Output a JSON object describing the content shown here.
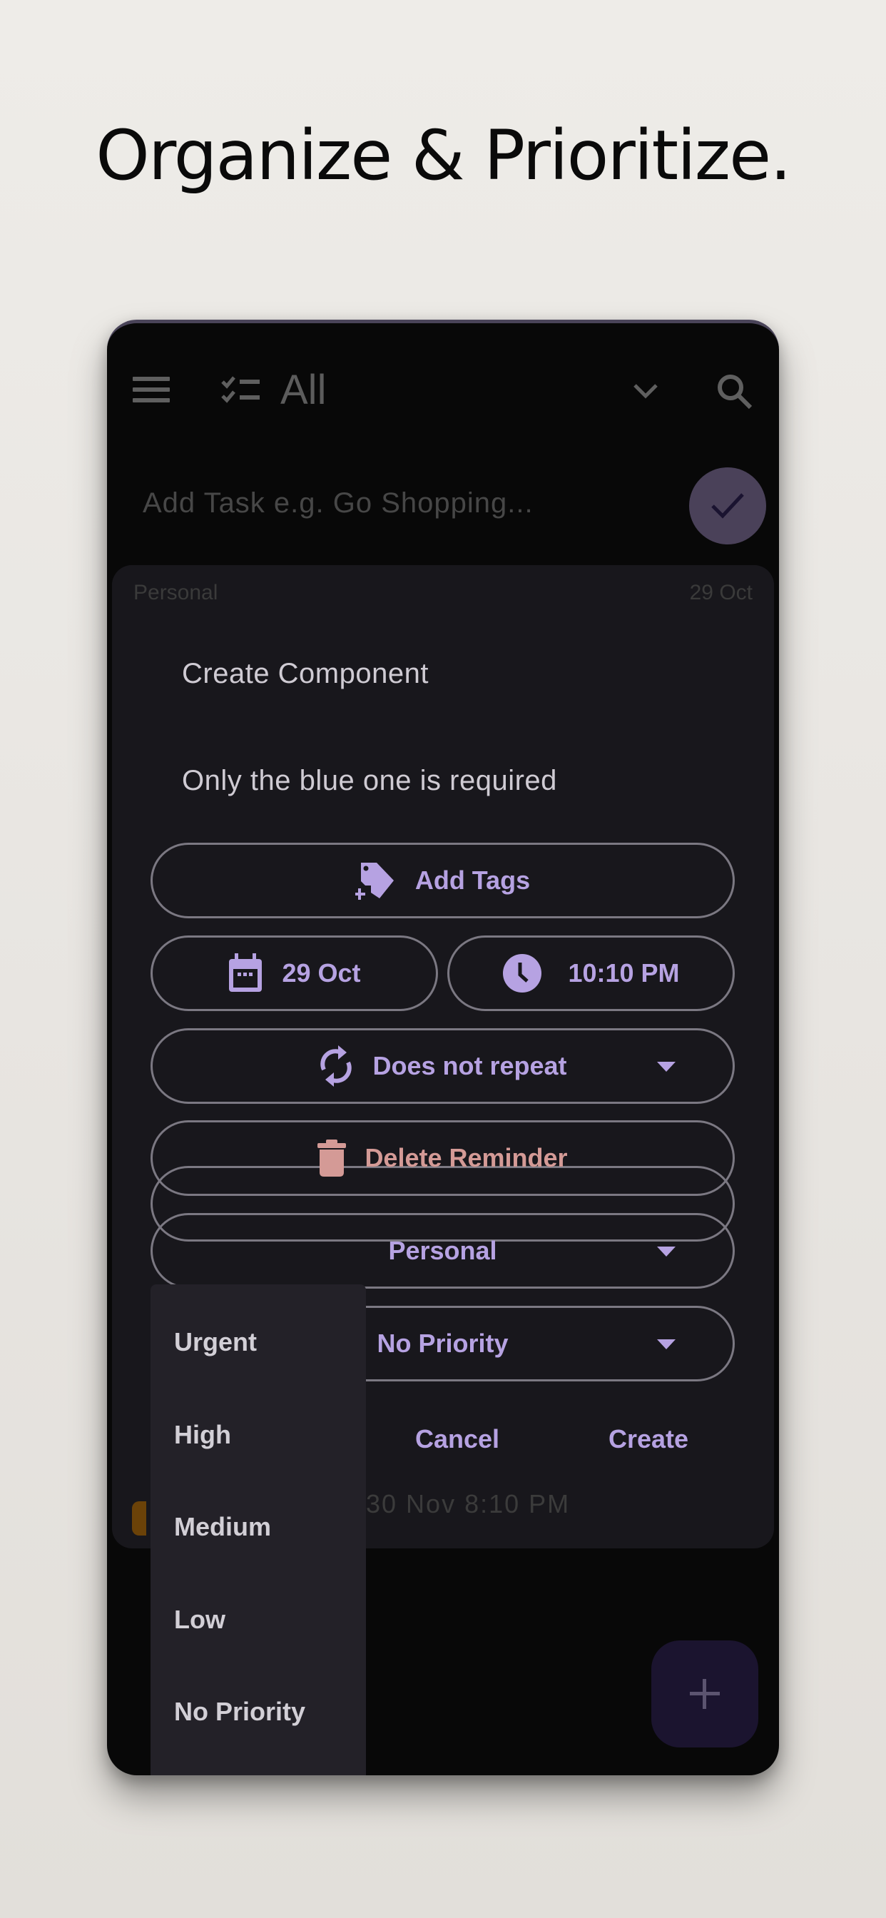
{
  "headline": "Organize & Prioritize.",
  "app_header": {
    "title": "All",
    "icons": [
      "menu-icon",
      "checklist-icon",
      "chevron-down-icon",
      "search-icon"
    ]
  },
  "add_task": {
    "placeholder": "Add Task e.g. Go Shopping...",
    "submit_icon": "check-icon"
  },
  "background_tasks": [
    {
      "category": "Personal",
      "date": "29 Oct"
    },
    {
      "date": "30 Nov 8:10 PM"
    }
  ],
  "dialog": {
    "title": "Create Component",
    "subtitle": "Only the blue one is required",
    "add_tags": {
      "label": "Add Tags",
      "icon": "tag-plus-icon"
    },
    "date": {
      "label": "29 Oct",
      "icon": "calendar-icon"
    },
    "time": {
      "label": "10:10 PM",
      "icon": "clock-icon"
    },
    "repeat": {
      "label": "Does not repeat",
      "icon": "repeat-icon"
    },
    "delete_reminder": {
      "label": "Delete Reminder",
      "icon": "trash-icon"
    },
    "category": {
      "label": "Personal"
    },
    "priority": {
      "label": "No Priority"
    },
    "cancel_label": "Cancel",
    "create_label": "Create"
  },
  "priority_menu": {
    "options": [
      "Urgent",
      "High",
      "Medium",
      "Low",
      "No Priority"
    ]
  },
  "fab": {
    "icon": "plus-icon"
  },
  "colors": {
    "accent": "#b6a2e2",
    "danger": "#d49a96",
    "dialog_bg": "#18171c",
    "menu_bg": "#232128",
    "fab_bg": "#1b142f"
  }
}
